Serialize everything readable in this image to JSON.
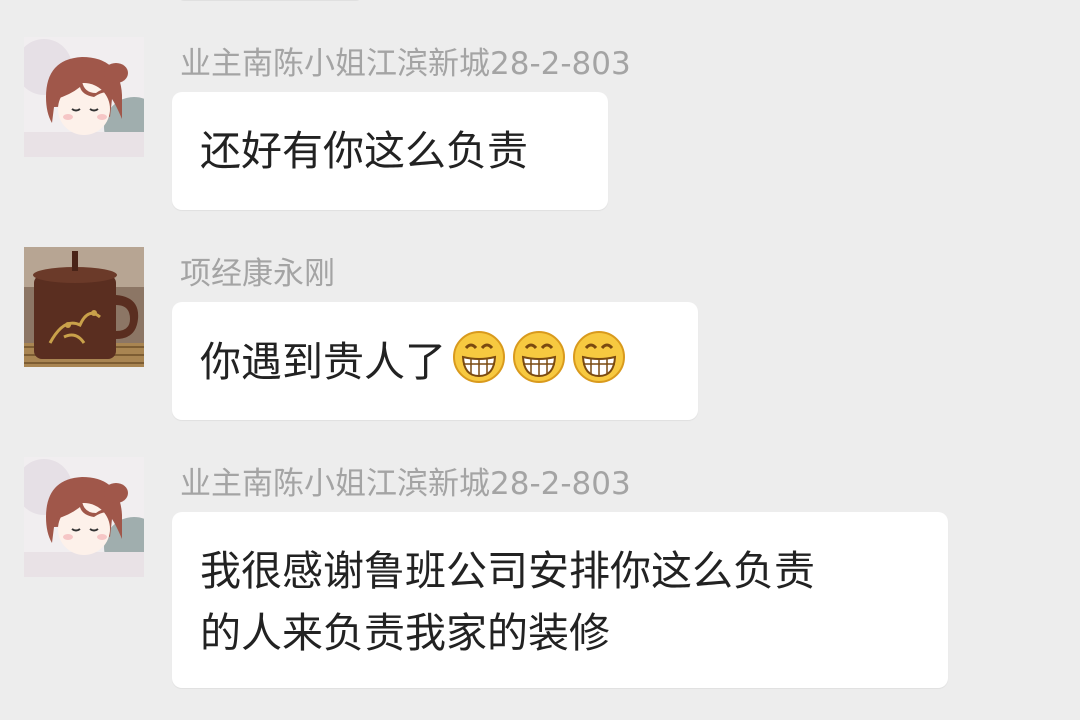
{
  "chat": {
    "messages": [
      {
        "sender": "业主南陈小姐江滨新城28-2-803",
        "text": "还好有你这么负责",
        "avatar": "cartoon-girl-avatar"
      },
      {
        "sender": "项经康永刚",
        "text": "你遇到贵人了",
        "avatar": "teapot-cup-avatar",
        "emojis": [
          "grinning-face-icon",
          "grinning-face-icon",
          "grinning-face-icon"
        ]
      },
      {
        "sender": "业主南陈小姐江滨新城28-2-803",
        "text": "我很感谢鲁班公司安排你这么负责\n的人来负责我家的装修",
        "avatar": "cartoon-girl-avatar"
      }
    ]
  },
  "colors": {
    "background": "#ededed",
    "bubble": "#ffffff",
    "sender_name": "#a4a4a4",
    "message_text": "#222222"
  }
}
